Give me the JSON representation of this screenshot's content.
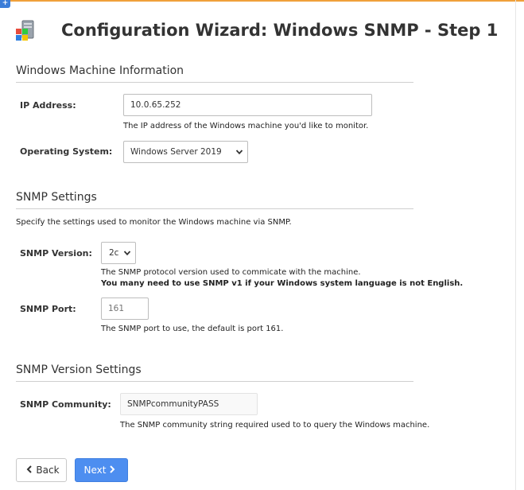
{
  "window": {
    "corner_tab": "+"
  },
  "header": {
    "title": "Configuration Wizard: Windows SNMP - Step 1",
    "logo_icon": "windows-computer-icon"
  },
  "machine_section": {
    "title": "Windows Machine Information",
    "ip_label": "IP Address:",
    "ip_value": "10.0.65.252",
    "ip_help": "The IP address of the Windows machine you'd like to monitor.",
    "os_label": "Operating System:",
    "os_selected": "Windows Server 2019"
  },
  "snmp_section": {
    "title": "SNMP Settings",
    "intro": "Specify the settings used to monitor the Windows machine via SNMP.",
    "version_label": "SNMP Version:",
    "version_selected": "2c",
    "version_help": "The SNMP protocol version used to commicate with the machine.",
    "version_warning": "You many need to use SNMP v1 if your Windows system language is not English.",
    "port_label": "SNMP Port:",
    "port_placeholder": "161",
    "port_help": "The SNMP port to use, the default is port 161."
  },
  "version_settings": {
    "title": "SNMP Version Settings",
    "community_label": "SNMP Community:",
    "community_value": "SNMPcommunityPASS",
    "community_help": "The SNMP community string required used to to query the Windows machine."
  },
  "buttons": {
    "back_label": "Back",
    "next_label": "Next"
  },
  "colors": {
    "accent_blue": "#4d8ef0",
    "top_border": "#f0a03a"
  }
}
